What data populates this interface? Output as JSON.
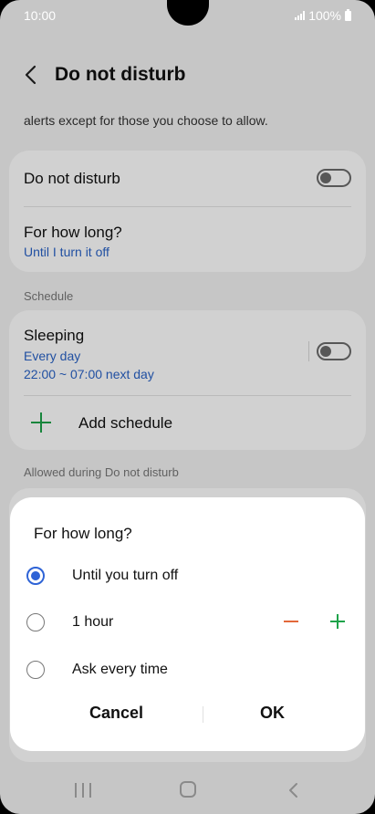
{
  "status": {
    "time": "10:00",
    "battery_text": "100%"
  },
  "header": {
    "title": "Do not disturb"
  },
  "description": "alerts except for those you choose to allow.",
  "main_card": {
    "dnd_label": "Do not disturb",
    "dnd_enabled": false,
    "duration_label": "For how long?",
    "duration_value": "Until I turn it off"
  },
  "schedule": {
    "section_label": "Schedule",
    "items": [
      {
        "title": "Sleeping",
        "days": "Every day",
        "time": "22:00 ~ 07:00 next day",
        "enabled": false
      }
    ],
    "add_label": "Add schedule"
  },
  "allowed_section_label": "Allowed during Do not disturb",
  "dialog": {
    "title": "For how long?",
    "options": [
      {
        "label": "Until you turn off",
        "selected": true
      },
      {
        "label": "1 hour",
        "selected": false
      },
      {
        "label": "Ask every time",
        "selected": false
      }
    ],
    "cancel_label": "Cancel",
    "ok_label": "OK"
  },
  "colors": {
    "accent": "#2e63d6",
    "link": "#2962c6",
    "add": "#1ea34a",
    "decrement": "#e3683a"
  }
}
